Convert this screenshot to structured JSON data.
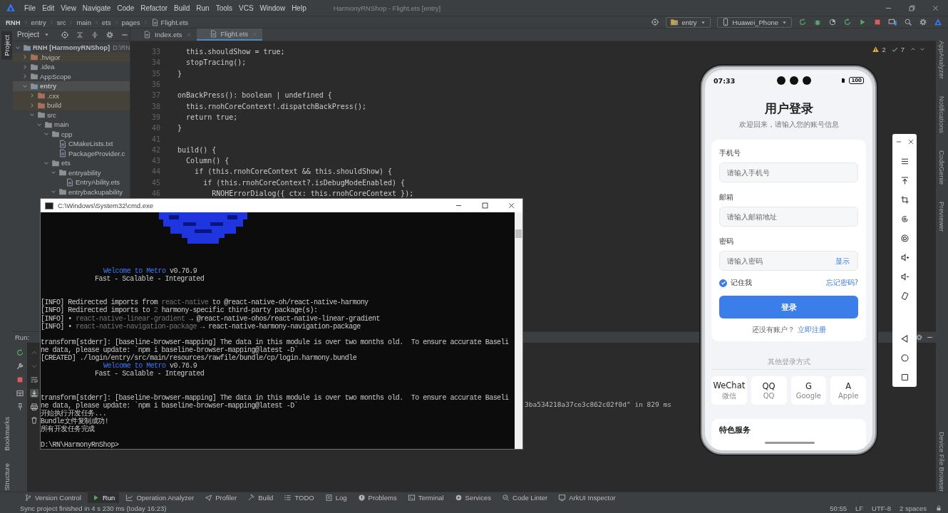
{
  "window": {
    "title": "HarmonyRNShop - Flight.ets [entry]"
  },
  "menu": [
    "File",
    "Edit",
    "View",
    "Navigate",
    "Code",
    "Refactor",
    "Build",
    "Run",
    "Tools",
    "VCS",
    "Window",
    "Help"
  ],
  "breadcrumb": [
    "RNH",
    "entry",
    "src",
    "main",
    "ets",
    "pages",
    "Flight.ets"
  ],
  "toolbar": {
    "module": "entry",
    "device": "Huawei_Phone"
  },
  "left_strip": [
    {
      "label": "Project",
      "selected": true
    },
    {
      "label": "Bookmarks",
      "selected": false
    },
    {
      "label": "Structure",
      "selected": false
    }
  ],
  "right_strip": [
    "AppAnalyzer",
    "Notifications",
    "CodeGenie",
    "Previewer",
    "Device File Browser"
  ],
  "project_panel": {
    "title": "Project",
    "tree": [
      {
        "label": "RNH [HarmonyRNShop]",
        "path": "D:\\RN",
        "kind": "module",
        "expanded": true,
        "excluded": false,
        "selected": false,
        "children": [
          {
            "label": ".hvigor",
            "kind": "folder",
            "expanded": false,
            "excluded": true,
            "selected": false
          },
          {
            "label": ".idea",
            "kind": "folder",
            "expanded": false,
            "excluded": false,
            "selected": false
          },
          {
            "label": "AppScope",
            "kind": "folder",
            "expanded": false,
            "excluded": false,
            "selected": false
          },
          {
            "label": "entry",
            "kind": "module",
            "expanded": true,
            "excluded": false,
            "selected": true,
            "children": [
              {
                "label": ".cxx",
                "kind": "folder",
                "expanded": false,
                "excluded": true,
                "selected": false
              },
              {
                "label": "build",
                "kind": "folder",
                "expanded": false,
                "excluded": true,
                "selected": false
              },
              {
                "label": "src",
                "kind": "folder",
                "expanded": true,
                "excluded": false,
                "selected": false,
                "children": [
                  {
                    "label": "main",
                    "kind": "folder",
                    "expanded": true,
                    "excluded": false,
                    "selected": false,
                    "children": [
                      {
                        "label": "cpp",
                        "kind": "folder",
                        "expanded": true,
                        "excluded": false,
                        "selected": false,
                        "children": [
                          {
                            "label": "CMakeLists.txt",
                            "kind": "file",
                            "excluded": false,
                            "selected": false
                          },
                          {
                            "label": "PackageProvider.c",
                            "kind": "file",
                            "excluded": false,
                            "selected": false
                          }
                        ]
                      },
                      {
                        "label": "ets",
                        "kind": "folder",
                        "expanded": true,
                        "excluded": false,
                        "selected": false,
                        "children": [
                          {
                            "label": "entryability",
                            "kind": "folder",
                            "expanded": true,
                            "excluded": false,
                            "selected": false,
                            "children": [
                              {
                                "label": "EntryAbility.ets",
                                "kind": "file",
                                "excluded": false,
                                "selected": false
                              }
                            ]
                          },
                          {
                            "label": "entrybackupability",
                            "kind": "folder",
                            "expanded": true,
                            "excluded": false,
                            "selected": false
                          }
                        ]
                      }
                    ]
                  }
                ]
              }
            ]
          }
        ]
      }
    ]
  },
  "editor": {
    "tabs": [
      {
        "label": "Index.ets",
        "selected": false
      },
      {
        "label": "Flight.ets",
        "selected": true
      }
    ],
    "inspections": {
      "warnings": "2",
      "weak_warnings": "7"
    },
    "lines": [
      {
        "number": "33",
        "text": "    this.shouldShow = true;"
      },
      {
        "number": "34",
        "text": "    stopTracing();"
      },
      {
        "number": "35",
        "text": "  }"
      },
      {
        "number": "36"
      },
      {
        "number": "37",
        "text": "  onBackPress(): boolean | undefined {"
      },
      {
        "number": "38",
        "text": "    this.rnohCoreContext!.dispatchBackPress();"
      },
      {
        "number": "39",
        "text": "    return true;"
      },
      {
        "number": "40",
        "text": "  }"
      },
      {
        "number": "41"
      },
      {
        "number": "42",
        "text": "  build() {"
      },
      {
        "number": "43",
        "text": "    Column() {"
      },
      {
        "number": "44",
        "text": "      if (this.rnohCoreContext && this.shouldShow) {"
      },
      {
        "number": "45",
        "text": "        if (this.rnohCoreContext?.isDebugModeEnabled) {"
      },
      {
        "number": "46",
        "text": "          RNOHErrorDialog({ ctx: this.rnohCoreContext });"
      }
    ]
  },
  "run_panel": {
    "title": "Run:",
    "output": [
      "3ba534218a37ce3c862c02f0d\" in 829 ms"
    ]
  },
  "terminal": {
    "title": "C:\\Windows\\System32\\cmd.exe",
    "lines": [
      {
        "kind": "banner",
        "parts": [
          {
            "text": "Welcome to Metro",
            "highlighted": true,
            "muted": false
          },
          {
            "text": " v0.76.9",
            "highlighted": false,
            "muted": false
          }
        ]
      },
      {
        "kind": "banner",
        "parts": [
          {
            "text": "Fast - Scalable - Integrated",
            "highlighted": false,
            "muted": false
          }
        ]
      },
      {
        "kind": "blank"
      },
      {
        "kind": "blank"
      },
      {
        "kind": "line",
        "parts": [
          {
            "text": "[INFO] Redirected imports from ",
            "highlighted": false,
            "muted": false
          },
          {
            "text": "react-native",
            "highlighted": false,
            "muted": true
          },
          {
            "text": " to @react-native-oh/react-native-harmony",
            "highlighted": false,
            "muted": false
          }
        ]
      },
      {
        "kind": "line",
        "parts": [
          {
            "text": "[INFO] Redirected imports to ",
            "highlighted": false,
            "muted": false
          },
          {
            "text": "2",
            "highlighted": false,
            "muted": true
          },
          {
            "text": " harmony-specific third-party package(s):",
            "highlighted": false,
            "muted": false
          }
        ]
      },
      {
        "kind": "line",
        "parts": [
          {
            "text": "[INFO] • ",
            "highlighted": false,
            "muted": false
          },
          {
            "text": "react-native-linear-gradient",
            "highlighted": false,
            "muted": true
          },
          {
            "text": " → @react-native-ohos/react-native-linear-gradient",
            "highlighted": false,
            "muted": false
          }
        ]
      },
      {
        "kind": "line",
        "parts": [
          {
            "text": "[INFO] • ",
            "highlighted": false,
            "muted": false
          },
          {
            "text": "react-native-navigation-package",
            "highlighted": false,
            "muted": true
          },
          {
            "text": " → react-native-harmony-navigation-package",
            "highlighted": false,
            "muted": false
          }
        ]
      },
      {
        "kind": "blank"
      },
      {
        "kind": "line",
        "parts": [
          {
            "text": "transform[stderr]: [baseline-browser-mapping] The data in this module is over two months old.  To ensure accurate Baseli"
          }
        ]
      },
      {
        "kind": "line",
        "parts": [
          {
            "text": "ne data, please update: `npm i baseline-browser-mapping@latest -D`"
          }
        ]
      },
      {
        "kind": "line",
        "parts": [
          {
            "text": "[CREATED] ./login/entry/src/main/resources/rawfile/bundle/cp/login.harmony.bundle"
          }
        ]
      },
      {
        "kind": "banner",
        "parts": [
          {
            "text": "Welcome to Metro",
            "highlighted": true,
            "muted": false
          },
          {
            "text": " v0.76.9",
            "highlighted": false,
            "muted": false
          }
        ]
      },
      {
        "kind": "banner",
        "parts": [
          {
            "text": "Fast - Scalable - Integrated",
            "highlighted": false,
            "muted": false
          }
        ]
      },
      {
        "kind": "blank"
      },
      {
        "kind": "blank"
      },
      {
        "kind": "line",
        "parts": [
          {
            "text": "transform[stderr]: [baseline-browser-mapping] The data in this module is over two months old.  To ensure accurate Baseli"
          }
        ]
      },
      {
        "kind": "line",
        "parts": [
          {
            "text": "ne data, please update: `npm i baseline-browser-mapping@latest -D`"
          }
        ]
      },
      {
        "kind": "line",
        "parts": [
          {
            "text": "开始执行开发任务..."
          }
        ]
      },
      {
        "kind": "line",
        "parts": [
          {
            "text": "Bundle文件复制成功!"
          }
        ]
      },
      {
        "kind": "line",
        "parts": [
          {
            "text": "所有开发任务完成"
          }
        ]
      },
      {
        "kind": "blank"
      },
      {
        "kind": "line",
        "parts": [
          {
            "text": "D:\\RN\\HarmonyRnShop>"
          }
        ]
      }
    ]
  },
  "phone": {
    "time": "07:33",
    "battery": "100",
    "title": "用户登录",
    "subtitle": "欢迎回来，请输入您的账号信息",
    "fields": [
      {
        "label": "手机号",
        "placeholder": "请输入手机号"
      },
      {
        "label": "邮箱",
        "placeholder": "请输入邮箱地址"
      },
      {
        "label": "密码",
        "placeholder": "请输入密码",
        "toggle": "显示"
      }
    ],
    "remember": {
      "label": "记住我",
      "checked": true
    },
    "forgot": "忘记密码?",
    "submit": "登录",
    "signup_prompt": "还没有账户？",
    "signup_link": "立即注册",
    "divider": "其他登录方式",
    "social": [
      {
        "name": "WeChat",
        "caption": "微信"
      },
      {
        "name": "QQ",
        "caption": "QQ"
      },
      {
        "name": "G",
        "caption": "Google"
      },
      {
        "name": "A",
        "caption": "Apple"
      }
    ],
    "section_title": "特色服务"
  },
  "bottom_tabs": [
    {
      "label": "Version Control",
      "selected": false
    },
    {
      "label": "Run",
      "selected": true
    },
    {
      "label": "Operation Analyzer",
      "selected": false
    },
    {
      "label": "Profiler",
      "selected": false
    },
    {
      "label": "Build",
      "selected": false
    },
    {
      "label": "TODO",
      "selected": false
    },
    {
      "label": "Log",
      "selected": false
    },
    {
      "label": "Problems",
      "selected": false
    },
    {
      "label": "Terminal",
      "selected": false
    },
    {
      "label": "Services",
      "selected": false
    },
    {
      "label": "Code Linter",
      "selected": false
    },
    {
      "label": "ArkUI Inspector",
      "selected": false
    }
  ],
  "status_bar": {
    "message": "Sync project finished in 4 s 230 ms (today 16:23)",
    "position": "50:55",
    "line_ending": "LF",
    "encoding": "UTF-8",
    "indent": "2 spaces"
  }
}
